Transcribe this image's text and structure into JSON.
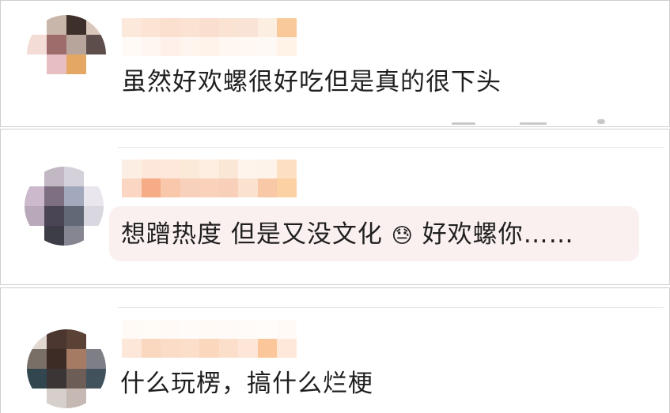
{
  "comments": [
    {
      "id": "c1",
      "text": "虽然好欢螺很好吃但是真的很下头",
      "emoji": "",
      "text_after_emoji": "",
      "avatar_colors": [
        "#ffffff",
        "#c9b6aa",
        "#3d2f2a",
        "#d9c7bb",
        "#f3dcd6",
        "#9e6d6b",
        "#b7a59c",
        "#5d4e4c",
        "#ffffff",
        "#e7bfc2",
        "#e4a764",
        "#ffffff",
        "#ffffff",
        "#ffffff",
        "#ffffff",
        "#ffffff"
      ],
      "name_colors": [
        "#fde9dc",
        "#fffaf6",
        "#fce3d3",
        "#fff6f1",
        "#fbdfcf",
        "#fff1e9",
        "#fbe2d2",
        "#fff5ef",
        "#fadfd0",
        "#fff3ea",
        "#fbe3d3",
        "#fff7f1",
        "#f8e3d6",
        "#fff8f3",
        "#fdeee2",
        "#fff9f5",
        "#fac999",
        "#fff3e8"
      ]
    },
    {
      "id": "c2",
      "text": "想蹭热度 但是又没文化",
      "emoji": "😓",
      "text_after_emoji": "好欢螺你……",
      "avatar_colors": [
        "#ffffff",
        "#c1b8c4",
        "#d4d1da",
        "#ffffff",
        "#cdb9cc",
        "#7e6f82",
        "#a3a9bd",
        "#e9e6ee",
        "#b8a8b9",
        "#4a4555",
        "#636877",
        "#d9d8e0",
        "#ffffff",
        "#3d3d48",
        "#868692",
        "#ffffff"
      ],
      "name_colors": [
        "#fdeee3",
        "#fbd7c3",
        "#fde7da",
        "#f6ad86",
        "#fde8db",
        "#f9c7aa",
        "#fcead9",
        "#f8d1bd",
        "#fdeee1",
        "#fad1bb",
        "#fbe7d6",
        "#f8cfb8",
        "#fef4ec",
        "#fbe2cf",
        "#fef3ea",
        "#f9c8a6",
        "#fddfc3",
        "#fcd1a3"
      ]
    },
    {
      "id": "c3",
      "text": "什么玩楞，搞什么烂梗",
      "emoji": "",
      "text_after_emoji": "",
      "avatar_colors": [
        "#e1d8d2",
        "#4b372f",
        "#5b4237",
        "#ffffff",
        "#7a6f67",
        "#3d2b25",
        "#a57b63",
        "#7e7f86",
        "#31464f",
        "#3b3535",
        "#6d5d57",
        "#42525d",
        "#ffffff",
        "#d6cfcc",
        "#c6b9b4",
        "#ffffff"
      ],
      "name_colors": [
        "#fffaf6",
        "#fde7d8",
        "#fffbf7",
        "#fad7bf",
        "#fffaf6",
        "#fbdcc6",
        "#fffbf8",
        "#fcdfca",
        "#fffaf6",
        "#fad7bd",
        "#fffaf7",
        "#fbdfca",
        "#fffbf8",
        "#fde6d7",
        "#fffcf9",
        "#fbc79a",
        "#fffaf6",
        "#fde8da"
      ]
    }
  ],
  "colors": {
    "bubble_bg": "#fbf0f0",
    "text": "#1f1f1f",
    "panel_border": "#cfcfcf"
  }
}
